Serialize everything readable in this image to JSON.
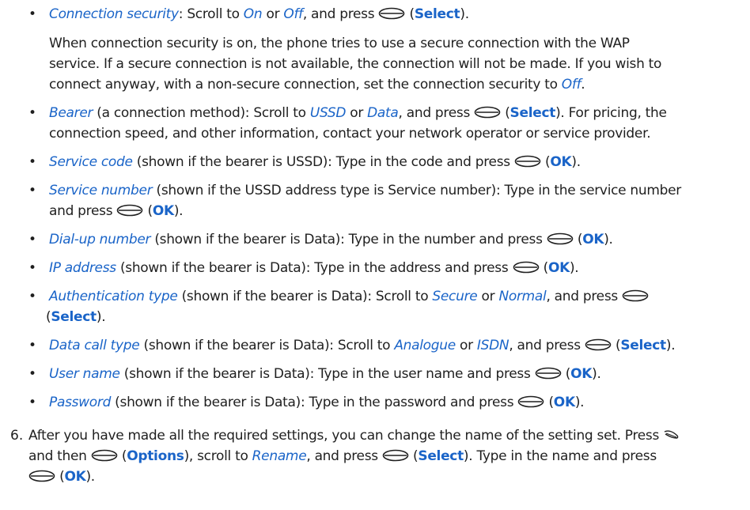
{
  "icons": {
    "select_key": "select-key-icon",
    "clear_key": "menu-key-icon",
    "bullet": "bullet-icon"
  },
  "colors": {
    "term": "#1a64c8",
    "text": "#1f1f1f"
  },
  "items": [
    {
      "term": "Connection security",
      "l1": [
        ": Scroll to ",
        "On",
        " or ",
        "Off",
        ", and press ",
        "",
        " (",
        "Select",
        ")."
      ],
      "para": [
        "When connection security is on, the phone tries to use a secure connection with the WAP",
        "service. If a secure connection is not available, the connection will not be made. If you wish to",
        "connect anyway, with a non-secure connection, set the connection security to "
      ],
      "para_end": "Off",
      "para_tail": "."
    },
    {
      "term": "Bearer",
      "a": " (a connection method): Scroll to ",
      "o1": "USSD",
      "or": " or ",
      "o2": "Data",
      "b": ", and press ",
      "k": "Select",
      "c": "). For pricing, the",
      "l2": "connection speed, and other information, contact your network operator or service provider."
    },
    {
      "term": "Service code",
      "a": " (shown if the bearer is USSD): Type in the code and press ",
      "k": "OK"
    },
    {
      "term": "Service number",
      "a": " (shown if the USSD address type is Service number): Type in the service number",
      "l2": "and press ",
      "k": "OK"
    },
    {
      "term": "Dial-up number",
      "a": " (shown if the bearer is Data): Type in the number and press ",
      "k": "OK"
    },
    {
      "term": "IP address",
      "a": " (shown if the bearer is Data): Type in the address and press ",
      "k": "OK"
    },
    {
      "term": "Authentication type",
      "a": " (shown if the bearer is Data): Scroll to ",
      "o1": "Secure",
      "or": " or ",
      "o2": "Normal",
      "b": ", and press ",
      "k": "Select"
    },
    {
      "term": "Data call type",
      "a": " (shown if the bearer is Data): Scroll to ",
      "o1": "Analogue",
      "or": " or ",
      "o2": "ISDN",
      "b": ", and press ",
      "k": "Select"
    },
    {
      "term": "User name",
      "a": " (shown if the bearer is Data): Type in the user name and press ",
      "k": "OK"
    },
    {
      "term": "Password",
      "a": " (shown if the bearer is Data): Type in the password and press ",
      "k": "OK"
    }
  ],
  "step6": {
    "number": "6.",
    "l1": "After you have made all the required settings, you can change the name of the setting set. Press",
    "l2a": "and then ",
    "opt": "Options",
    "l2b": "), scroll to ",
    "ren": "Rename",
    "l2c": ", and press ",
    "sel": "Select",
    "l2d": "). Type in the name and press",
    "ok": "OK"
  },
  "punct": {
    "open": " (",
    "close": ")",
    "close_dot": ").",
    "dot": "."
  }
}
